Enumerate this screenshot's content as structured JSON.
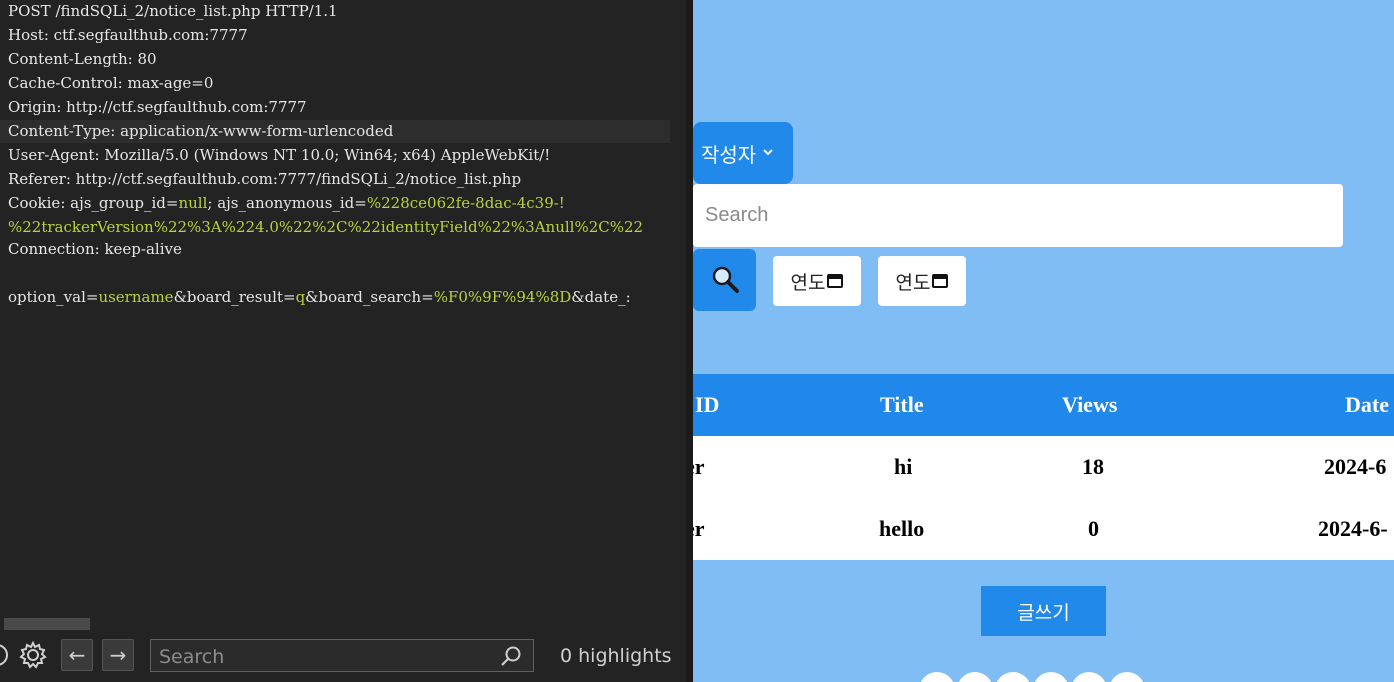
{
  "request": {
    "lines": [
      [
        {
          "t": "POST /findSQLi_2/notice_list.php HTTP/1.1",
          "c": "k"
        }
      ],
      [
        {
          "t": "Host",
          "c": "k"
        },
        {
          "t": ": ctf.segfaulthub.com:7777",
          "c": "v"
        }
      ],
      [
        {
          "t": "Content-Length",
          "c": "k"
        },
        {
          "t": ": 80",
          "c": "v"
        }
      ],
      [
        {
          "t": "Cache-Control",
          "c": "k"
        },
        {
          "t": ": max-age=0",
          "c": "v"
        }
      ],
      [
        {
          "t": "Origin",
          "c": "k"
        },
        {
          "t": ": http://ctf.segfaulthub.com:7777",
          "c": "v"
        }
      ],
      [
        {
          "t": "Content-Type",
          "c": "k"
        },
        {
          "t": ": application/x-www-form-urlencoded",
          "c": "v"
        }
      ],
      [
        {
          "t": "User-Agent",
          "c": "k"
        },
        {
          "t": ": Mozilla/5.0 (Windows NT 10.0; Win64; x64) AppleWebKit/!",
          "c": "v"
        }
      ],
      [
        {
          "t": "Referer",
          "c": "k"
        },
        {
          "t": ": http://ctf.segfaulthub.com:7777/findSQLi_2/notice_list.php",
          "c": "v"
        }
      ],
      [
        {
          "t": "Cookie",
          "c": "k"
        },
        {
          "t": ": ajs_group_id=",
          "c": "v"
        },
        {
          "t": "null",
          "c": "g"
        },
        {
          "t": "; ajs_anonymous_id=",
          "c": "v"
        },
        {
          "t": "%228ce062fe-8dac-4c39-!",
          "c": "g"
        }
      ],
      [
        {
          "t": "%22trackerVersion%22%3A%224.0%22%2C%22identityField%22%3Anull%2C%22",
          "c": "g"
        }
      ],
      [
        {
          "t": "Connection",
          "c": "k"
        },
        {
          "t": ": keep-alive",
          "c": "v"
        }
      ],
      [],
      [
        {
          "t": "option_val=",
          "c": "v"
        },
        {
          "t": "username",
          "c": "g"
        },
        {
          "t": "&board_result=",
          "c": "v"
        },
        {
          "t": "q",
          "c": "g"
        },
        {
          "t": "&board_search=",
          "c": "v"
        },
        {
          "t": "%F0%9F%94%8D",
          "c": "g"
        },
        {
          "t": "&date_:",
          "c": "v"
        }
      ]
    ]
  },
  "editor_bar": {
    "search_placeholder": "Search",
    "highlights_text": "0 highlights",
    "icons": [
      "help-icon",
      "gear-icon",
      "arrow-left-icon",
      "arrow-right-icon",
      "search-icon"
    ]
  },
  "page": {
    "option_select_label": "작성자",
    "search_placeholder": "Search",
    "date_from_label": "연도",
    "date_to_label": "연도",
    "table": {
      "headers": [
        "ID",
        "Title",
        "Views",
        "Date"
      ],
      "rows": [
        {
          "id": "er",
          "title": "hi",
          "views": "18",
          "date": "2024-6"
        },
        {
          "id": "er",
          "title": "hello",
          "views": "0",
          "date": "2024-6-"
        }
      ]
    },
    "write_button": "글쓰기"
  },
  "colors": {
    "editor_bg": "#232323",
    "cookie_value_green": "#b5d33f",
    "page_bg": "#80bdf4",
    "primary_blue": "#2189ea",
    "table_header_blue": "#1f88ea"
  }
}
